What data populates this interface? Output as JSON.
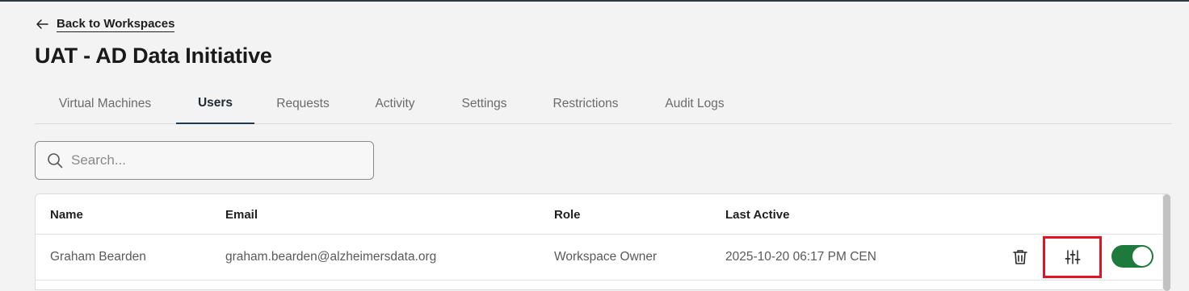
{
  "nav": {
    "back_label": "Back to Workspaces"
  },
  "page": {
    "title": "UAT - AD Data Initiative"
  },
  "tabs": [
    {
      "label": "Virtual Machines",
      "active": false
    },
    {
      "label": "Users",
      "active": true
    },
    {
      "label": "Requests",
      "active": false
    },
    {
      "label": "Activity",
      "active": false
    },
    {
      "label": "Settings",
      "active": false
    },
    {
      "label": "Restrictions",
      "active": false
    },
    {
      "label": "Audit Logs",
      "active": false
    }
  ],
  "search": {
    "placeholder": "Search...",
    "value": ""
  },
  "table": {
    "columns": [
      "Name",
      "Email",
      "Role",
      "Last Active"
    ],
    "rows": [
      {
        "name": "Graham Bearden",
        "email": "graham.bearden@alzheimersdata.org",
        "role": "Workspace Owner",
        "last_active": "2025-10-20 06:17 PM CEN",
        "enabled": true
      }
    ]
  },
  "icons": {
    "back": "arrow-left-icon",
    "search": "search-icon",
    "delete": "trash-icon",
    "permissions": "sliders-icon"
  },
  "colors": {
    "toggle_on": "#1e7a3c",
    "highlight": "#e5121f",
    "active_tab": "#1f3b4d"
  }
}
